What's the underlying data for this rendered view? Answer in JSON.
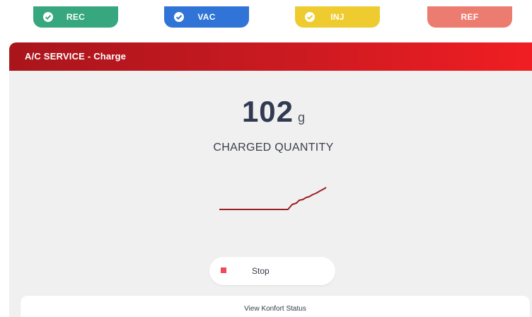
{
  "steps": [
    {
      "label": "REC",
      "completed": true,
      "color": "#36a77e"
    },
    {
      "label": "VAC",
      "completed": true,
      "color": "#2f74d6"
    },
    {
      "label": "INJ",
      "completed": true,
      "color": "#eecc2f"
    },
    {
      "label": "REF",
      "completed": false,
      "color": "#ed7c70"
    }
  ],
  "panel": {
    "title": "A/C SERVICE - Charge",
    "header_color": "#cc1a21"
  },
  "charge": {
    "value": "102",
    "unit": "g",
    "label": "CHARGED QUANTITY"
  },
  "actions": {
    "stop_label": "Stop",
    "view_status_label": "View Konfort Status"
  },
  "icons": {
    "check": "check-circle-icon",
    "stop": "stop-square-icon"
  }
}
